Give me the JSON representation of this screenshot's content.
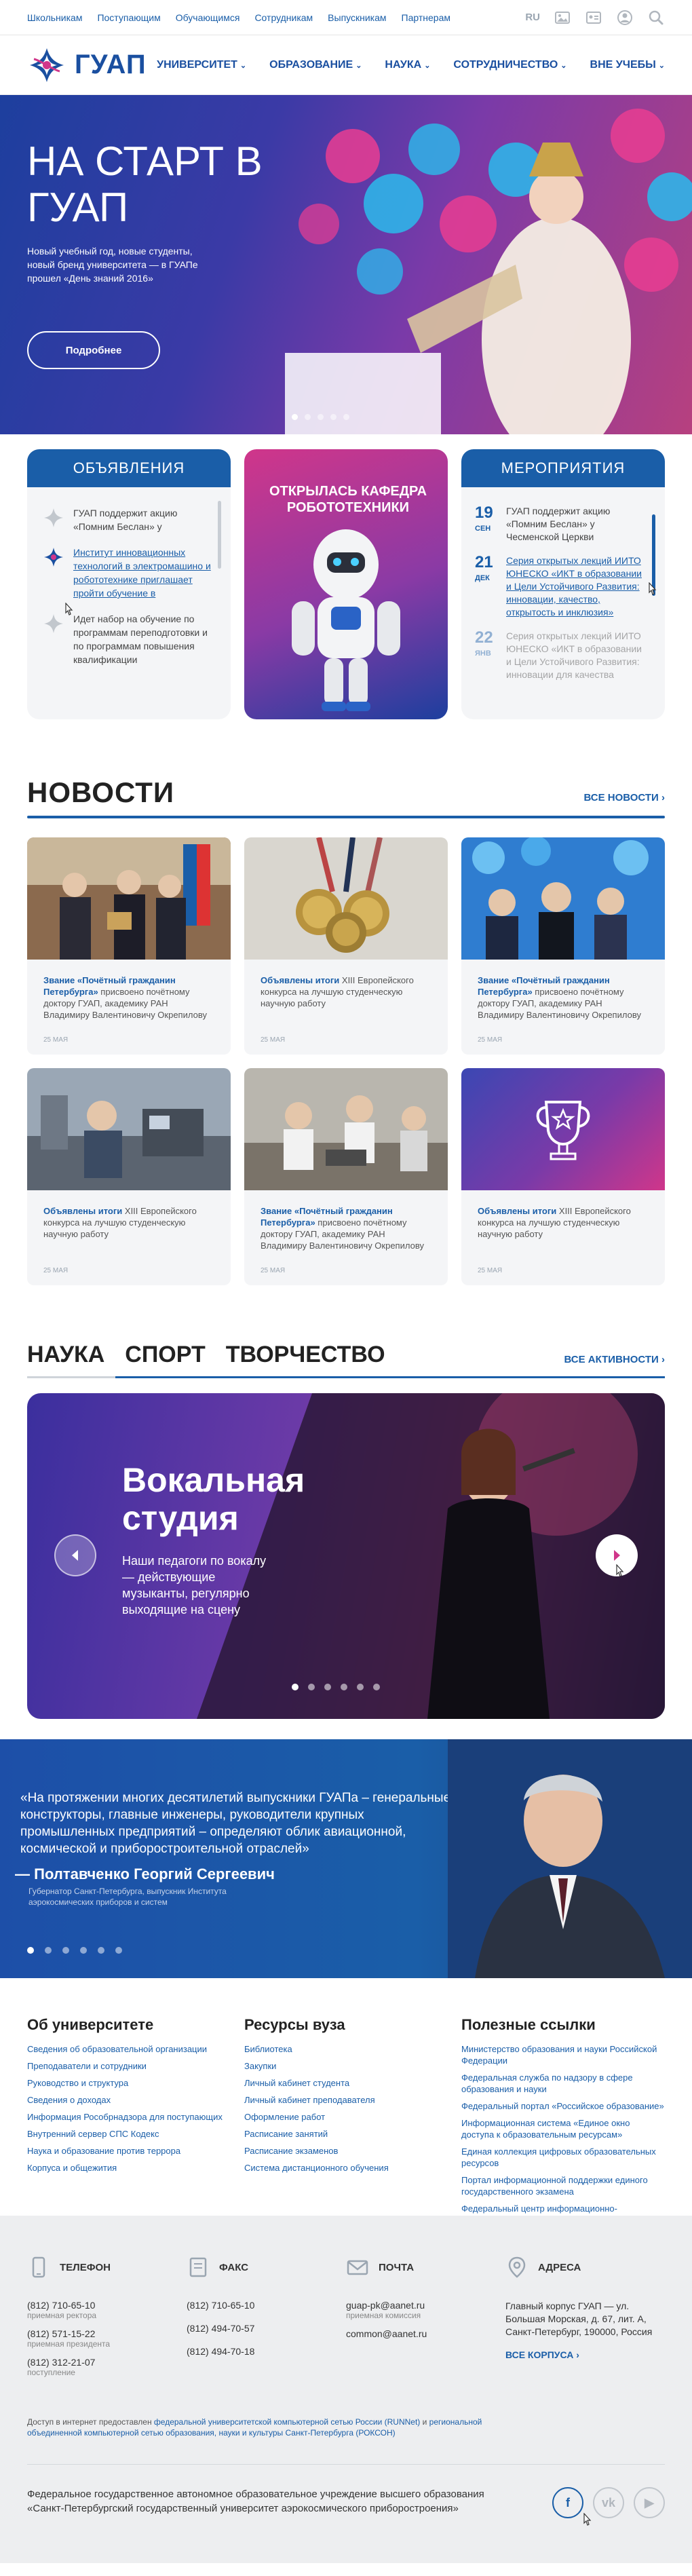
{
  "topbar": {
    "links": [
      "Школьникам",
      "Поступающим",
      "Обучающимся",
      "Сотрудникам",
      "Выпускникам",
      "Партнерам"
    ],
    "lang": "RU",
    "icons": [
      "image-icon",
      "id-card-icon",
      "user-icon",
      "search-icon"
    ]
  },
  "nav": {
    "logo_text": "ГУАП",
    "menu": [
      "Университет",
      "Образование",
      "Наука",
      "Сотрудничество",
      "Вне учебы"
    ]
  },
  "hero": {
    "title": "На старт в ГУАП",
    "text": "Новый учебный год, новые студенты, новый бренд университета — в ГУАПе прошел «День знаний 2016»",
    "button": "Подробнее",
    "slides_total": 5,
    "slide_active": 1
  },
  "announcements": {
    "title": "Объявления",
    "items": [
      {
        "text": "ГУАП поддержит акцию «Помним Беслан» у",
        "style": "normal"
      },
      {
        "text": "Институт инновационных технологий в электромашино и робототехнике приглашает пройти обучение в",
        "style": "link"
      },
      {
        "text": "Идет набор на обучение по программам переподготовки и по программам повышения квалификации",
        "style": "normal"
      }
    ]
  },
  "promo": {
    "title": "Открылась кафедра робототехники"
  },
  "events": {
    "title": "Мероприятия",
    "items": [
      {
        "day": "19",
        "month": "сен",
        "text": "ГУАП поддержит акцию «Помним Беслан» у Чесменской Церкви",
        "style": "normal"
      },
      {
        "day": "21",
        "month": "дек",
        "text": "Серия открытых лекций ИИТО ЮНЕСКО «ИКТ в образовании и Цели Устойчивого Развития: инновации, качество, открытость и инклюзия»",
        "style": "link"
      },
      {
        "day": "22",
        "month": "янв",
        "text": "Серия открытых лекций ИИТО ЮНЕСКО «ИКТ в образовании и Цели Устойчивого Развития: инновации для качества",
        "style": "faded"
      }
    ]
  },
  "news": {
    "title": "Новости",
    "all_label": "Все новости",
    "items": [
      {
        "bold": "Звание «Почётный гражданин Петербурга»",
        "rest": " присвоено почётному доктору ГУАП, академику РАН Владимиру Валентиновичу Окрепилову",
        "date": "25 мая",
        "img": "ceremony"
      },
      {
        "bold": "Объявлены итоги",
        "rest": " XIII Европейского конкурса на лучшую студенческую научную работу",
        "date": "25 мая",
        "img": "medals"
      },
      {
        "bold": "Звание «Почётный гражданин Петербурга»",
        "rest": " присвоено почётному доктору ГУАП, академику РАН Владимиру Валентиновичу Окрепилову",
        "date": "25 мая",
        "img": "crowd"
      },
      {
        "bold": "Объявлены итоги",
        "rest": " XIII Европейского конкурса на лучшую студенческую научную работу",
        "date": "25 мая",
        "img": "lab"
      },
      {
        "bold": "Звание «Почётный гражданин Петербурга»",
        "rest": " присвоено почётному доктору ГУАП, академику РАН Владимиру Валентиновичу Окрепилову",
        "date": "25 мая",
        "img": "workshop"
      },
      {
        "bold": "Объявлены итоги",
        "rest": " XIII Европейского конкурса на лучшую студенческую научную работу",
        "date": "25 мая",
        "img": "trophy"
      }
    ]
  },
  "activities": {
    "tabs": [
      "Наука",
      "Спорт",
      "Творчество"
    ],
    "active_tab": "Творчество",
    "all_label": "Все активности",
    "slide_title": "Вокальная студия",
    "slide_text": "Наши педагоги по вокалу — действующие музыканты, регулярно выходящие на сцену",
    "slides_total": 6,
    "slide_active": 1
  },
  "quote": {
    "text": "«На протяжении многих десятилетий выпускники ГУАПа – генеральные конструкторы, главные инженеры, руководители крупных промышленных предприятий – определяют облик авиационной, космической и приборостроительной отраслей»",
    "author": "Полтавченко Георгий Сергеевич",
    "role": "Губернатор Санкт-Петербурга, выпускник Института аэрокосмических приборов и систем",
    "slides_total": 6,
    "slide_active": 1
  },
  "footer_links": {
    "about": {
      "title": "Об университете",
      "links": [
        "Сведения об образовательной организации",
        "Преподаватели и сотрудники",
        "Руководство и структура",
        "Сведения о доходах",
        "Информация Рособрнадзора для поступающих",
        "Внутренний сервер СПС Кодекс",
        "Наука и образование против террора",
        "Корпуса и общежития"
      ]
    },
    "resources": {
      "title": "Ресурсы вуза",
      "links": [
        "Библиотека",
        "Закупки",
        "Личный кабинет студента",
        "Личный кабинет преподавателя",
        "Оформление работ",
        "Расписание занятий",
        "Расписание экзаменов",
        "Система дистанционного обучения"
      ]
    },
    "useful": {
      "title": "Полезные ссылки",
      "links": [
        "Министерство образования и науки Российской Федерации",
        "Федеральная служба по надзору в сфере образования и науки",
        "Федеральный портал «Российское образование»",
        "Информационная система «Единое окно доступа к образовательным ресурсам»",
        "Единая коллекция цифровых образовательных ресурсов",
        "Портал информационной поддержки единого государственного экзамена",
        "Федеральный центр информационно-образовательных ресурсов"
      ]
    }
  },
  "contacts": {
    "phone": {
      "title": "Телефон",
      "rows": [
        {
          "value": "(812) 710-65-10",
          "sub": "приемная ректора"
        },
        {
          "value": "(812) 571-15-22",
          "sub": "приемная президента"
        },
        {
          "value": "(812) 312-21-07",
          "sub": "поступление"
        }
      ]
    },
    "fax": {
      "title": "Факс",
      "rows": [
        {
          "value": "(812) 710-65-10",
          "sub": ""
        },
        {
          "value": "(812) 494-70-57",
          "sub": ""
        },
        {
          "value": "(812) 494-70-18",
          "sub": ""
        }
      ]
    },
    "mail": {
      "title": "Почта",
      "rows": [
        {
          "value": "guap-pk@aanet.ru",
          "sub": "приемная комиссия"
        },
        {
          "value": "common@aanet.ru",
          "sub": ""
        }
      ]
    },
    "address": {
      "title": "Адреса",
      "text": "Главный корпус ГУАП — ул. Большая Морская, д. 67, лит. А, Санкт-Петербург, 190000, Россия",
      "more": "Все корпуса"
    },
    "legal_prefix": "Доступ в интернет предоставлен ",
    "legal_link1": "федеральной университетской компьютерной сетью России (RUNNet)",
    "legal_mid": " и ",
    "legal_link2": "региональной объединенной компьютерной сетью образования, науки и культуры Санкт-Петербурга (РОКСОН)",
    "org": "Федеральное государственное автономное образовательное учреждение высшего образования «Санкт-Петербургский государственный университет аэрокосмического приборостроения»",
    "social": [
      {
        "name": "facebook",
        "glyph": "f"
      },
      {
        "name": "vk",
        "glyph": "vk"
      },
      {
        "name": "youtube",
        "glyph": "▶"
      }
    ]
  },
  "colors": {
    "brand_blue": "#1a5ea8",
    "brand_pink": "#d0368a",
    "light_bg": "#f4f5f7"
  }
}
